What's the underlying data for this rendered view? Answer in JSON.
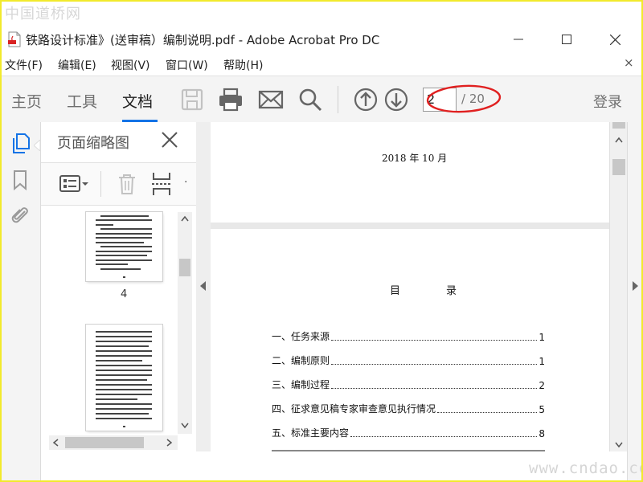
{
  "watermarks": {
    "top_left": "中国道桥网",
    "bottom_right": "www.cndao.com"
  },
  "window": {
    "title": "铁路设计标准》(送审稿）编制说明.pdf - Adobe Acrobat Pro DC",
    "controls": [
      "minimize",
      "maximize",
      "close"
    ]
  },
  "menu": {
    "items": [
      "文件(F)",
      "编辑(E)",
      "视图(V)",
      "窗口(W)",
      "帮助(H)"
    ],
    "close_label": "×"
  },
  "toolbar": {
    "tabs": [
      "主页",
      "工具",
      "文档"
    ],
    "active_tab": "文档",
    "page_current": "2",
    "page_total": "/ 20",
    "login_label": "登录",
    "accent_color": "#1473e6",
    "highlight_color": "#e02020"
  },
  "thumbnail_panel": {
    "title": "页面缩略图",
    "pages": [
      {
        "label": "4"
      },
      {
        "label": ""
      }
    ]
  },
  "document": {
    "page1_date": "2018 年 10 月",
    "toc_title": "目　录",
    "toc": [
      {
        "text": "一、任务来源",
        "page": "1"
      },
      {
        "text": "二、编制原则",
        "page": "1"
      },
      {
        "text": "三、编制过程",
        "page": "2"
      },
      {
        "text": "四、征求意见稿专家审查意见执行情况",
        "page": "5"
      },
      {
        "text": "五、标准主要内容",
        "page": "8"
      }
    ]
  }
}
